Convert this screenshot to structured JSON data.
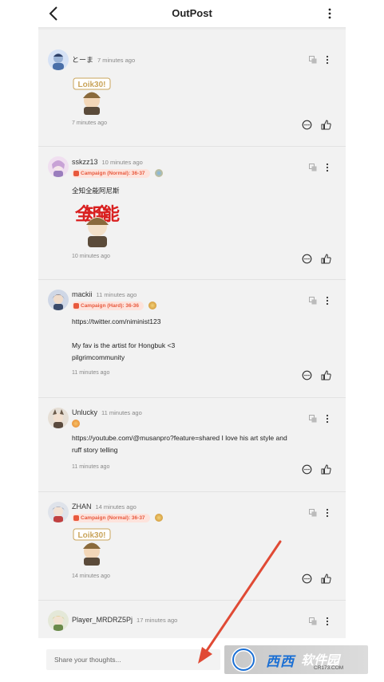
{
  "header": {
    "title": "OutPost"
  },
  "comments": [
    {
      "username": "とーま",
      "time": "7 minutes ago",
      "badge": "",
      "text": "",
      "sticker_text": "Loik30!",
      "timestamp": "7 minutes ago"
    },
    {
      "username": "sskzz13",
      "time": "10 minutes ago",
      "badge": "Campaign (Normal): 36-37",
      "text": "全知全能阿尼斯",
      "sticker_text": "全知全能",
      "timestamp": "10 minutes ago"
    },
    {
      "username": "mackii",
      "time": "11 minutes ago",
      "badge": "Campaign (Hard): 36-36",
      "text_lines": [
        "https://twitter.com/niminist123",
        "",
        "My fav is the artist for Hongbuk <3",
        "pilgrimcommunity"
      ],
      "timestamp": "11 minutes ago"
    },
    {
      "username": "Unlucky",
      "time": "11 minutes ago",
      "badge": "",
      "text_lines": [
        "https://youtube.com/@musanpro?feature=shared I love his art style and",
        "ruff story telling"
      ],
      "timestamp": "11 minutes ago"
    },
    {
      "username": "ZHAN",
      "time": "14 minutes ago",
      "badge": "Campaign (Normal): 36-37",
      "text": "",
      "sticker_text": "Loik30!",
      "timestamp": "14 minutes ago"
    },
    {
      "username": "Player_MRDRZ5Pj",
      "time": "17 minutes ago",
      "badge": "",
      "text": "",
      "timestamp": ""
    }
  ],
  "composer": {
    "placeholder": "Share your thoughts..."
  },
  "watermark": {
    "main": "西西",
    "second": "软件园",
    "sub": "CR173.COM"
  },
  "colors": {
    "badge_bg": "#fde3dc",
    "badge_fg": "#e8593d",
    "arrow": "#e04a35",
    "panel_bg": "#f2f2f2"
  }
}
